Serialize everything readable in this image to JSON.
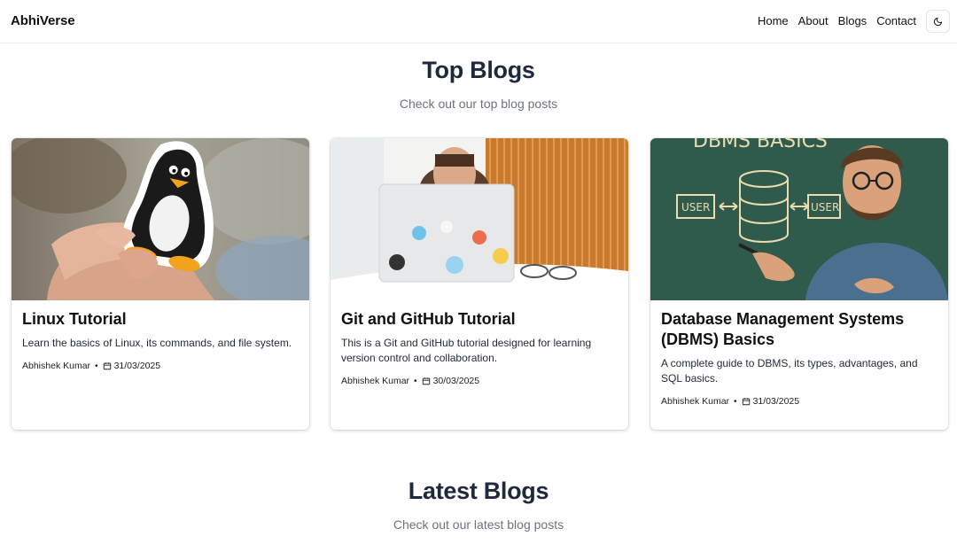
{
  "header": {
    "brand": "AbhiVerse",
    "nav": [
      "Home",
      "About",
      "Blogs",
      "Contact"
    ],
    "theme_icon": "moon-icon"
  },
  "top": {
    "title": "Top Blogs",
    "subtitle": "Check out our top blog posts"
  },
  "cards": [
    {
      "title": "Linux Tutorial",
      "description": "Learn the basics of Linux, its commands, and file system.",
      "author": "Abhishek Kumar",
      "date": "31/03/2025",
      "image": "linux-penguin-sticker"
    },
    {
      "title": "Git and GitHub Tutorial",
      "description": "This is a Git and GitHub tutorial designed for learning version control and collaboration.",
      "author": "Abhishek Kumar",
      "date": "30/03/2025",
      "image": "laptop-github-stickers"
    },
    {
      "title": "Database Management Systems (DBMS) Basics",
      "description": "A complete guide to DBMS, its types, advantages, and SQL basics.",
      "author": "Abhishek Kumar",
      "date": "31/03/2025",
      "image": "dbms-chalkboard-illustration",
      "image_text": {
        "heading": "DBMS BASICS",
        "left_box": "USER",
        "right_box": "USER"
      }
    }
  ],
  "latest": {
    "title": "Latest Blogs",
    "subtitle": "Check out our latest blog posts"
  }
}
